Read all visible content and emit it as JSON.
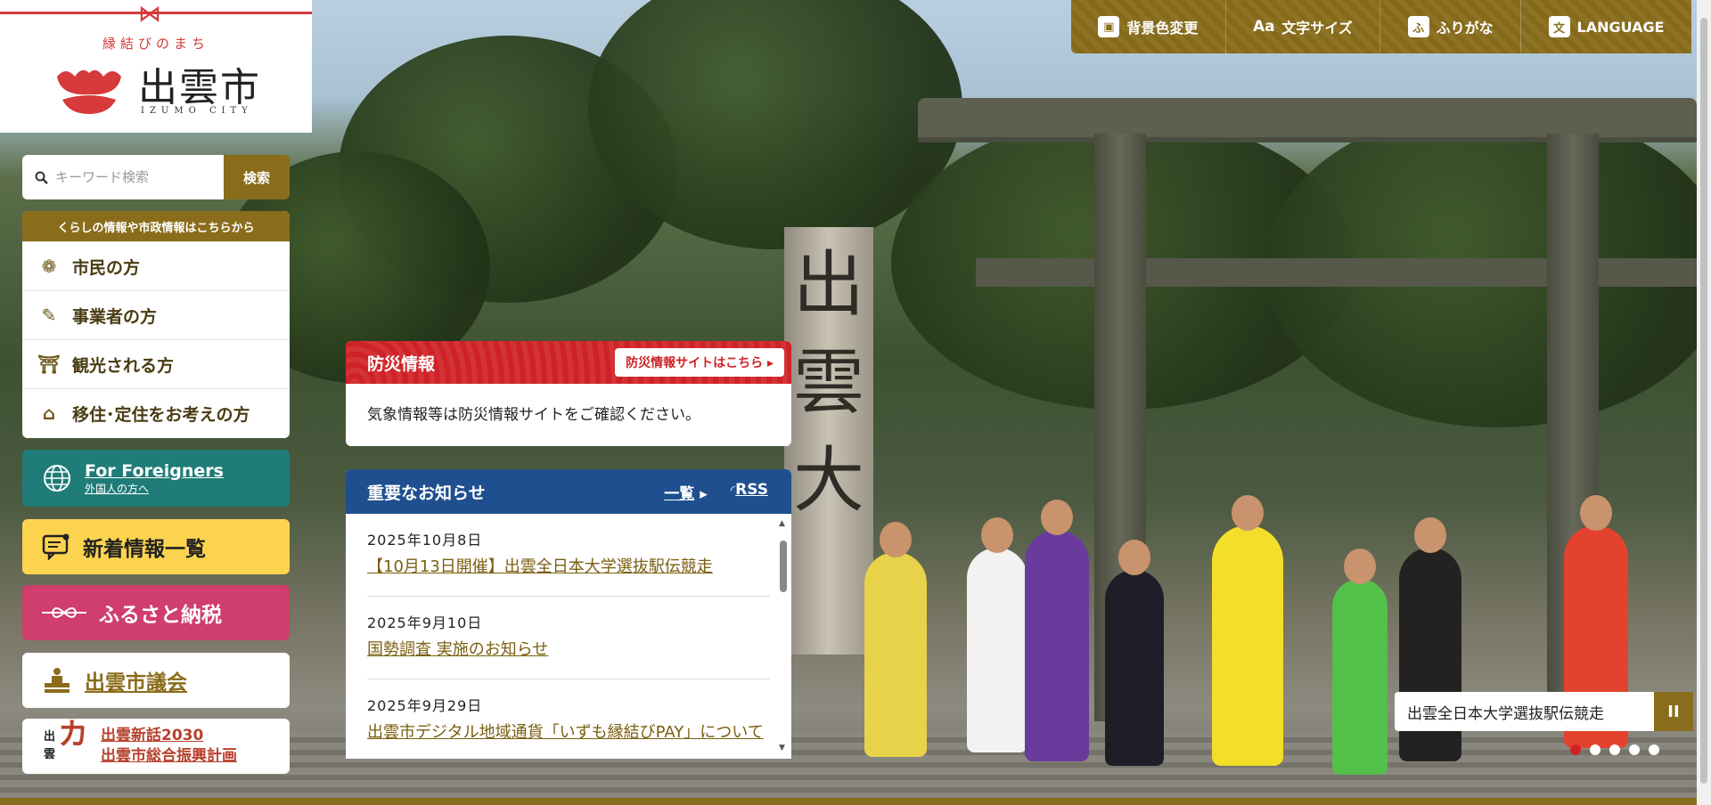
{
  "logo": {
    "tagline": "縁結びのまち",
    "name": "出雲市",
    "sub": "IZUMO CITY"
  },
  "toolbar": {
    "items": [
      {
        "label": "背景色変更",
        "icon": "color-icon"
      },
      {
        "label": "文字サイズ",
        "icon": "text-size-icon",
        "glyph": "Aa"
      },
      {
        "label": "ふりがな",
        "icon": "furigana-icon",
        "glyph": "ふ"
      },
      {
        "label": "LANGUAGE",
        "icon": "language-icon",
        "glyph": "文"
      }
    ]
  },
  "search": {
    "placeholder": "キーワード検索",
    "button": "検索"
  },
  "nav": {
    "header": "くらしの情報や市政情報はこちらから",
    "items": [
      {
        "label": "市民の方",
        "icon": "flower-icon"
      },
      {
        "label": "事業者の方",
        "icon": "pen-icon"
      },
      {
        "label": "観光される方",
        "icon": "shrine-icon"
      },
      {
        "label": "移住･定住をお考えの方",
        "icon": "house-icon"
      }
    ]
  },
  "foreigners": {
    "title": "For Foreigners",
    "sub": "外国人の方へ"
  },
  "news_list": "新着情報一覧",
  "furusato": "ふるさと納税",
  "gikai": "出雲市議会",
  "plan": {
    "line1": "出雲新話2030",
    "line2": "出雲市総合振興計画"
  },
  "bousai": {
    "title": "防災情報",
    "link": "防災情報サイトはこちら",
    "body": "気象情報等は防災情報サイトをご確認ください。"
  },
  "notice": {
    "title": "重要なお知らせ",
    "list_link": "一覧",
    "rss": "RSS",
    "items": [
      {
        "date": "2025年10月8日",
        "title": "【10月13日開催】出雲全日本大学選抜駅伝競走"
      },
      {
        "date": "2025年9月10日",
        "title": "国勢調査 実施のお知らせ"
      },
      {
        "date": "2025年9月29日",
        "title": "出雲市デジタル地域通貨「いずも縁結びPAY」について"
      }
    ]
  },
  "hero": {
    "post_text": "出雲大",
    "caption": "出雲全日本大学選抜駅伝競走",
    "pause": "II",
    "slides": 5,
    "active_slide": 1
  },
  "colors": {
    "brand_gold": "#8a6d1c",
    "disaster_red": "#cf2226",
    "notice_blue": "#1f4f8f",
    "foreigner_teal": "#1f7c78",
    "news_yellow": "#fbd34f",
    "furusato_pink": "#cf3e6c"
  }
}
